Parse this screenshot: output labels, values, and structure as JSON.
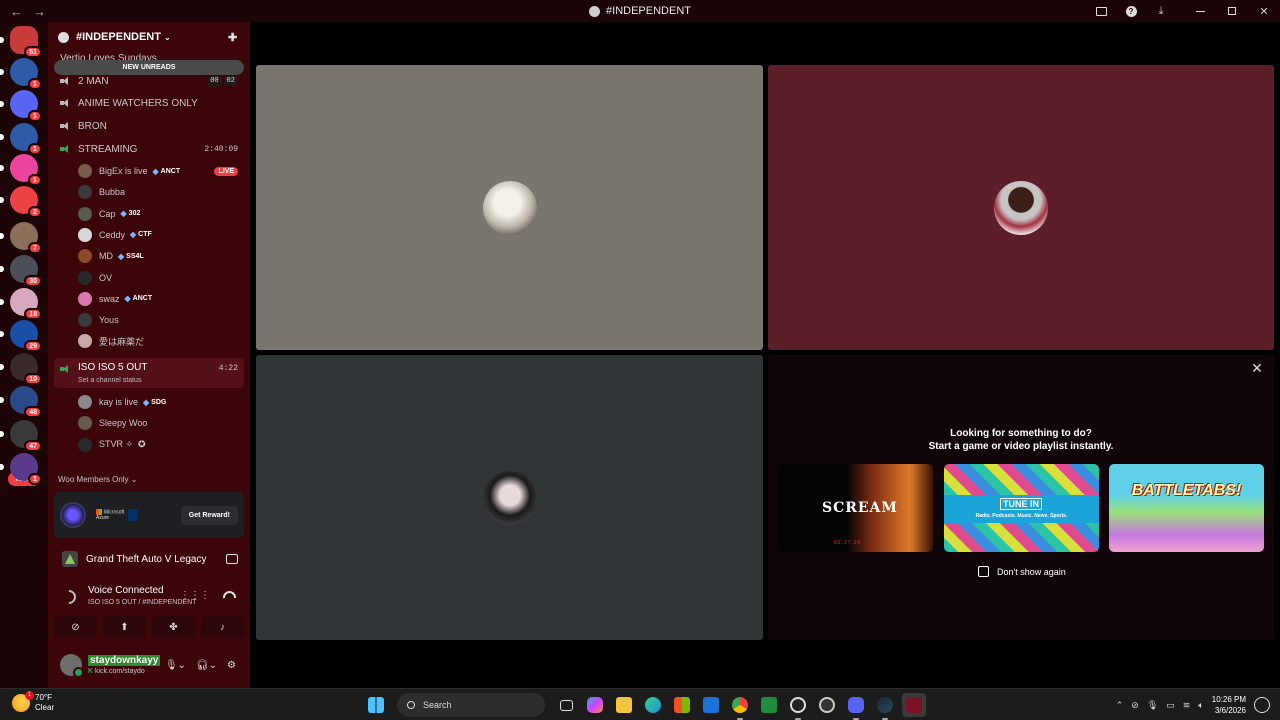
{
  "titlebar": {
    "back": "←",
    "forward": "→",
    "title": "#INDEPENDENT",
    "icons": [
      "screen-share-icon",
      "help-icon",
      "download-icon",
      "minimize-icon",
      "maximize-icon",
      "close-icon"
    ]
  },
  "servers": [
    {
      "badge": "51",
      "color": "#c93a3a"
    },
    {
      "badge": "1",
      "color": "#2f5aa8"
    },
    {
      "badge": "1",
      "color": "#5865f2"
    },
    {
      "badge": "1",
      "color": "#2f5aa8"
    },
    {
      "badge": "1",
      "color": "#eb459e"
    },
    {
      "badge": "2",
      "color": "#ed4245"
    },
    {
      "badge": "7",
      "color": "#8a6f5a"
    },
    {
      "badge": "30",
      "color": "#4a4f5a"
    },
    {
      "badge": "18",
      "color": "#d8a8c0"
    },
    {
      "badge": "29",
      "color": "#1a4fa8"
    },
    {
      "badge": "10",
      "color": "#3a2a2a"
    },
    {
      "badge": "48",
      "color": "#2a4a8a"
    },
    {
      "badge": "47",
      "color": "#3a3a3a"
    },
    {
      "badge": "1",
      "color": "#5a3a8a"
    }
  ],
  "rail_new": "NEW",
  "guild": {
    "name": "#INDEPENDENT",
    "cut_channel": "Vertio Loves Sundays",
    "new_unreads": "NEW UNREADS"
  },
  "channels": {
    "two_man": {
      "name": "2 MAN",
      "count_a": "00",
      "count_b": "02"
    },
    "anime": {
      "name": "ANIME WATCHERS ONLY"
    },
    "bron": {
      "name": "BRON"
    },
    "streaming": {
      "name": "STREAMING",
      "timer": "2:40:09"
    },
    "iso": {
      "name": "ISO ISO 5 OUT",
      "timer": "4:22",
      "status": "Set a channel status"
    }
  },
  "streaming_users": [
    {
      "name": "BigEx is live",
      "tag": "ANCT",
      "live": "LIVE",
      "color": "#7a5a4a"
    },
    {
      "name": "Bubba",
      "tag": "",
      "color": "#3a3a3a"
    },
    {
      "name": "Cap",
      "tag": "302",
      "color": "#5a5a4a"
    },
    {
      "name": "Ceddy",
      "tag": "CTF",
      "color": "#d8d8d8"
    },
    {
      "name": "MD",
      "tag": "SS4L",
      "color": "#8a4a2a"
    },
    {
      "name": "OV",
      "tag": "",
      "color": "#2a2a2a"
    },
    {
      "name": "swaz",
      "tag": "ANCT",
      "color": "#d87ab0"
    },
    {
      "name": "Yous",
      "tag": "",
      "color": "#3a3a3a"
    },
    {
      "name": "愛は麻薬だ",
      "tag": "",
      "color": "#c8a8a8"
    }
  ],
  "iso_users": [
    {
      "name": "kay is live",
      "tag": "SDG",
      "color": "#8a8a8a"
    },
    {
      "name": "Sleepy Woo",
      "tag": "",
      "color": "#6a5a4a"
    },
    {
      "name": "STVR ✧",
      "tag": "",
      "star": "✪",
      "color": "#2a2a2a"
    }
  ],
  "category": "Woo Members Only",
  "promo": {
    "brand": "Microsoft Azure",
    "button": "Get Reward!"
  },
  "activity": {
    "game": "Grand Theft Auto V Legacy"
  },
  "voice": {
    "title": "Voice Connected",
    "subtitle": "ISO ISO 5 OUT / #INDEPENDENT"
  },
  "user": {
    "name": "staydownkayy",
    "status": "kick.com/staydo"
  },
  "discovery": {
    "line1": "Looking for something to do?",
    "line2": "Start a game or video playlist instantly.",
    "cards": [
      {
        "title": "SCREAM",
        "date": "02.27.26"
      },
      {
        "title": "TUNE IN",
        "tagline": "Radio. Podcasts. Music. News. Sports."
      },
      {
        "title": "BATTLETABS!"
      }
    ],
    "checkbox": "Don't show again"
  },
  "taskbar": {
    "temp": "70°F",
    "condition": "Clear",
    "weather_badge": "1",
    "search_placeholder": "Search",
    "time": "10:26 PM",
    "date": "3/6/2026"
  }
}
